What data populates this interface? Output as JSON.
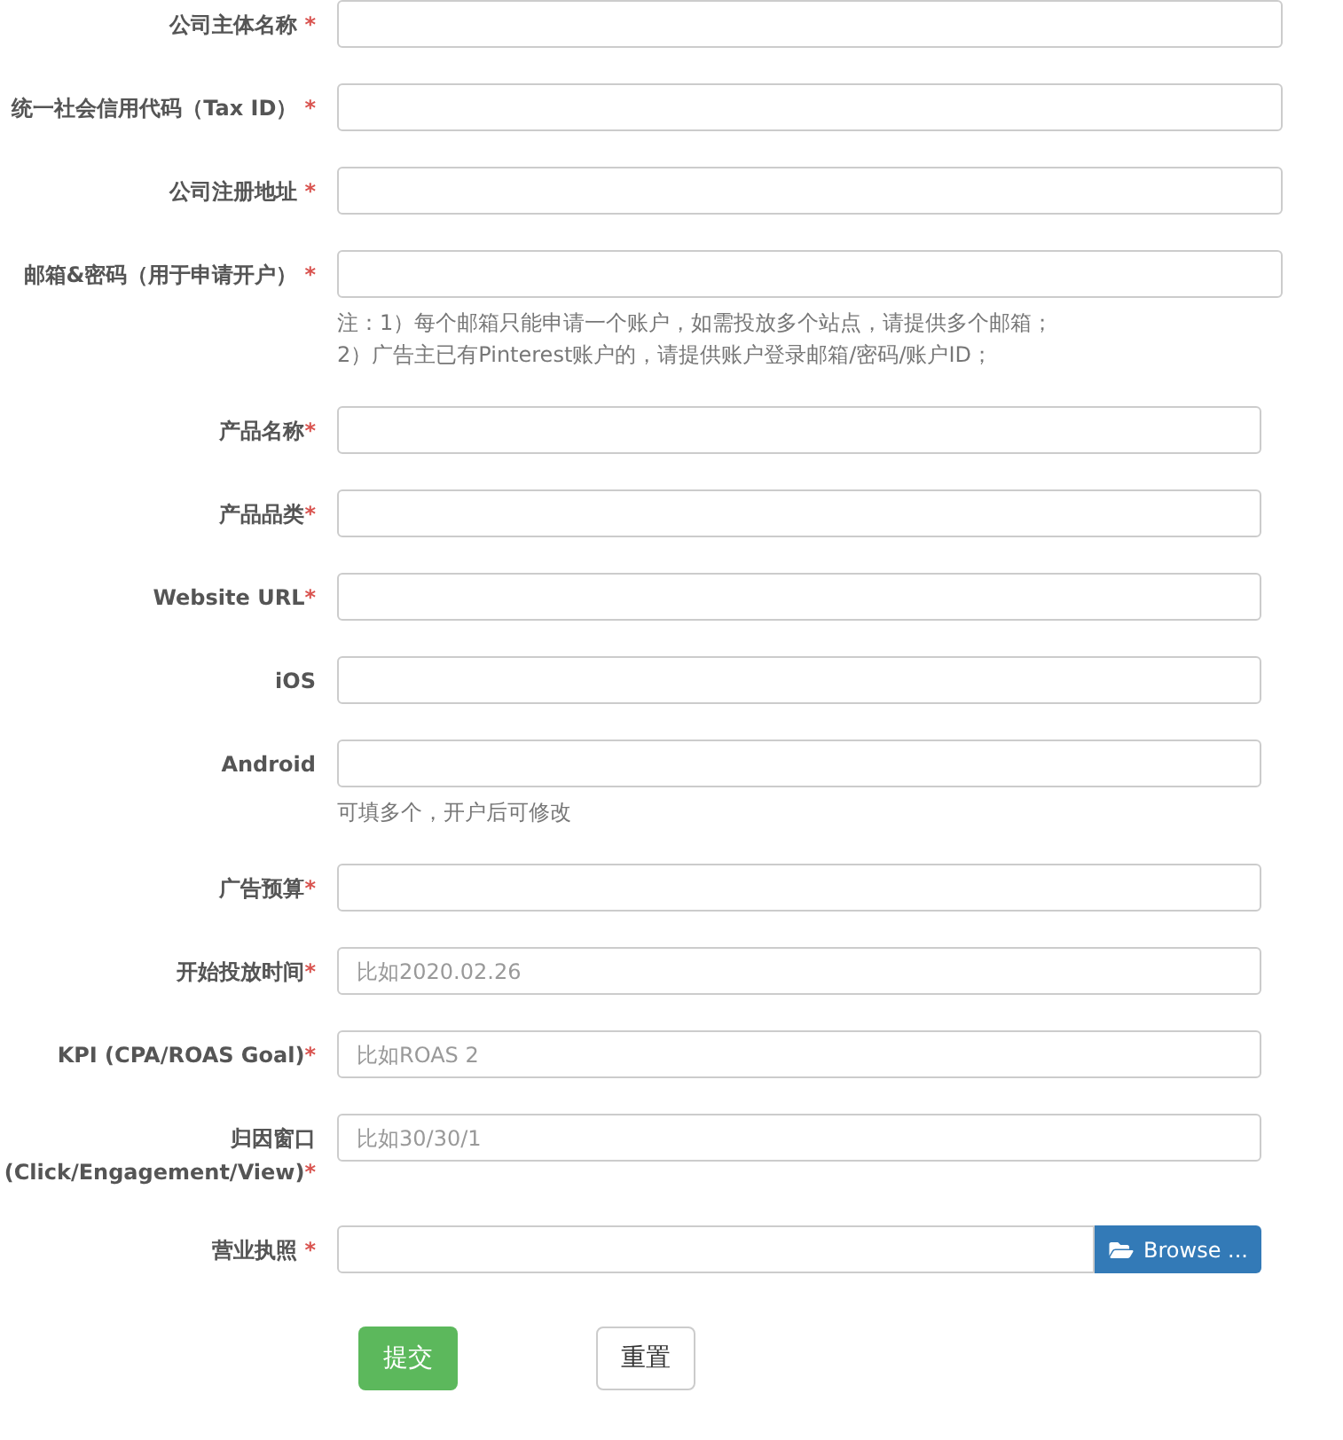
{
  "sections": [
    {
      "fields": [
        {
          "label": "公司主体名称",
          "mark": "*",
          "spaced": true,
          "kind": "text"
        },
        {
          "label": "统一社会信用代码（Tax ID）",
          "mark": "*",
          "spaced": true,
          "kind": "text"
        },
        {
          "label": "公司注册地址",
          "mark": "*",
          "spaced": true,
          "kind": "text"
        },
        {
          "label": "邮箱&密码（用于申请开户）",
          "mark": "*",
          "spaced": true,
          "kind": "text",
          "notes": [
            "注：1）每个邮箱只能申请一个账户，如需投放多个站点，请提供多个邮箱；",
            "2）广告主已有Pinterest账户的，请提供账户登录邮箱/密码/账户ID；"
          ]
        }
      ]
    },
    {
      "fields": [
        {
          "label": "产品名称",
          "mark": "*",
          "spaced": false,
          "kind": "text"
        },
        {
          "label": "产品品类",
          "mark": "*",
          "spaced": false,
          "kind": "text"
        },
        {
          "label": "Website URL",
          "mark": "*",
          "spaced": false,
          "kind": "text"
        },
        {
          "label": "iOS",
          "kind": "text"
        },
        {
          "label": "Android",
          "kind": "text",
          "notes": [
            "可填多个，开户后可修改"
          ]
        },
        {
          "label": "广告预算",
          "mark": "*",
          "spaced": false,
          "kind": "text"
        },
        {
          "label": "开始投放时间",
          "mark": "*",
          "spaced": false,
          "kind": "text",
          "placeholder": "比如2020.02.26"
        },
        {
          "label": "KPI (CPA/ROAS Goal)",
          "mark": "*",
          "spaced": false,
          "kind": "text",
          "placeholder": "比如ROAS 2"
        },
        {
          "label": "归因窗口 (Click/Engagement/View)",
          "mark": "*",
          "spaced": false,
          "kind": "text",
          "placeholder": "比如30/30/1"
        },
        {
          "label": "营业执照",
          "mark": "*",
          "spaced": true,
          "kind": "file",
          "button": "Browse ..."
        }
      ]
    }
  ],
  "buttons": [
    {
      "label": "提交",
      "kind": "primary"
    },
    {
      "label": "重置",
      "kind": "default"
    }
  ]
}
